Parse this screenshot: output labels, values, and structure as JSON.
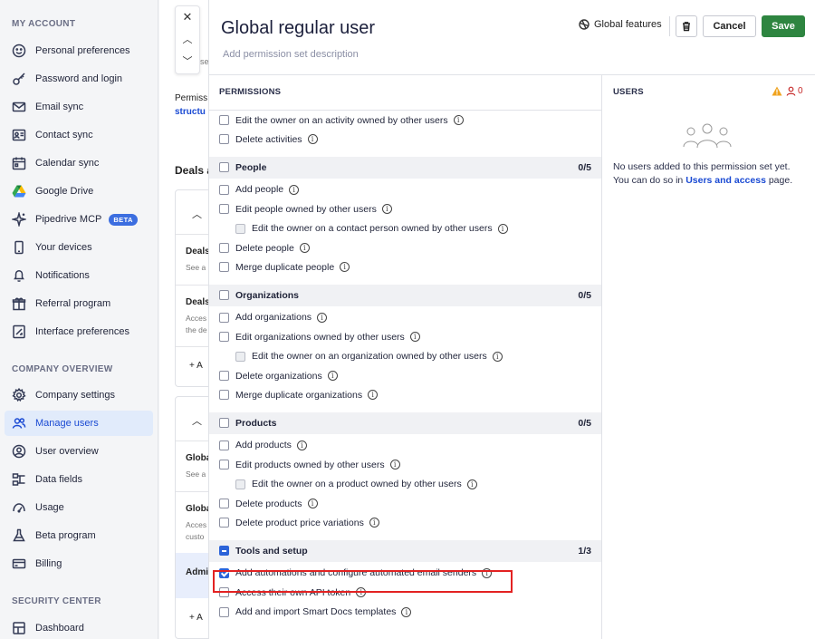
{
  "sidebar": {
    "sections": [
      {
        "heading": "MY ACCOUNT",
        "items": [
          {
            "label": "Personal preferences",
            "icon": "smiley-icon"
          },
          {
            "label": "Password and login",
            "icon": "key-icon"
          },
          {
            "label": "Email sync",
            "icon": "mail-icon"
          },
          {
            "label": "Contact sync",
            "icon": "contact-card-icon"
          },
          {
            "label": "Calendar sync",
            "icon": "calendar-icon"
          },
          {
            "label": "Google Drive",
            "icon": "google-drive-icon"
          },
          {
            "label": "Pipedrive MCP",
            "icon": "sparkle-icon",
            "badge": "BETA"
          },
          {
            "label": "Your devices",
            "icon": "phone-icon"
          },
          {
            "label": "Notifications",
            "icon": "bell-icon"
          },
          {
            "label": "Referral program",
            "icon": "gift-icon"
          },
          {
            "label": "Interface preferences",
            "icon": "interface-icon"
          }
        ]
      },
      {
        "heading": "COMPANY OVERVIEW",
        "items": [
          {
            "label": "Company settings",
            "icon": "gear-icon"
          },
          {
            "label": "Manage users",
            "icon": "users-icon",
            "active": true
          },
          {
            "label": "User overview",
            "icon": "user-circle-icon"
          },
          {
            "label": "Data fields",
            "icon": "data-fields-icon"
          },
          {
            "label": "Usage",
            "icon": "gauge-icon"
          },
          {
            "label": "Beta program",
            "icon": "flask-icon"
          },
          {
            "label": "Billing",
            "icon": "credit-card-icon"
          }
        ]
      },
      {
        "heading": "SECURITY CENTER",
        "items": [
          {
            "label": "Dashboard",
            "icon": "dashboard-icon"
          }
        ]
      }
    ]
  },
  "background": {
    "perm_text": "Permiss",
    "link_text": "structu",
    "deals_heading": "Deals a",
    "card1_rows": [
      {
        "title": "Deals",
        "sub": "See a"
      },
      {
        "title": "Deals",
        "sub": "Acces",
        "sub2": "the de"
      }
    ],
    "card1_add": "+ A",
    "card2_rows": [
      {
        "title": "Globa",
        "sub": "See a"
      },
      {
        "title": "Globa",
        "sub": "Acces",
        "sub2": "custo"
      },
      {
        "title": "Admi"
      }
    ],
    "card2_add": "+ A",
    "desc_fragment": "se"
  },
  "panel": {
    "title": "Global regular user",
    "description_placeholder": "Add permission set description",
    "global_features_label": "Global features",
    "cancel_label": "Cancel",
    "save_label": "Save",
    "permissions_heading": "PERMISSIONS",
    "users_heading": "USERS",
    "users_count": "0",
    "empty_text_1": "No users added to this permission set yet. You can do so in",
    "empty_link": "Users and access",
    "empty_text_2": "page.",
    "colors": {
      "save_green": "#2e8540",
      "accent_blue": "#2c64d9",
      "highlight_red": "#e32222"
    }
  },
  "permissions": [
    {
      "type": "item",
      "label": "Edit the owner on an activity owned by other users",
      "info": true,
      "checked": false
    },
    {
      "type": "item",
      "label": "Delete activities",
      "info": true,
      "checked": false
    },
    {
      "type": "group",
      "label": "People",
      "count": "0/5",
      "state": "unchecked"
    },
    {
      "type": "item",
      "label": "Add people",
      "info": true,
      "checked": false
    },
    {
      "type": "item",
      "label": "Edit people owned by other users",
      "info": true,
      "checked": false
    },
    {
      "type": "sub",
      "label": "Edit the owner on a contact person owned by other users",
      "info": true,
      "checked": false
    },
    {
      "type": "item",
      "label": "Delete people",
      "info": true,
      "checked": false
    },
    {
      "type": "item",
      "label": "Merge duplicate people",
      "info": true,
      "checked": false
    },
    {
      "type": "group",
      "label": "Organizations",
      "count": "0/5",
      "state": "unchecked"
    },
    {
      "type": "item",
      "label": "Add organizations",
      "info": true,
      "checked": false
    },
    {
      "type": "item",
      "label": "Edit organizations owned by other users",
      "info": true,
      "checked": false
    },
    {
      "type": "sub",
      "label": "Edit the owner on an organization owned by other users",
      "info": true,
      "checked": false
    },
    {
      "type": "item",
      "label": "Delete organizations",
      "info": true,
      "checked": false
    },
    {
      "type": "item",
      "label": "Merge duplicate organizations",
      "info": true,
      "checked": false
    },
    {
      "type": "group",
      "label": "Products",
      "count": "0/5",
      "state": "unchecked"
    },
    {
      "type": "item",
      "label": "Add products",
      "info": true,
      "checked": false
    },
    {
      "type": "item",
      "label": "Edit products owned by other users",
      "info": true,
      "checked": false
    },
    {
      "type": "sub",
      "label": "Edit the owner on a product owned by other users",
      "info": true,
      "checked": false
    },
    {
      "type": "item",
      "label": "Delete products",
      "info": true,
      "checked": false
    },
    {
      "type": "item",
      "label": "Delete product price variations",
      "info": true,
      "checked": false
    },
    {
      "type": "group",
      "label": "Tools and setup",
      "count": "1/3",
      "state": "partial"
    },
    {
      "type": "item",
      "label": "Add automations and configure automated email senders",
      "info": true,
      "checked": true
    },
    {
      "type": "item",
      "label": "Access their own API token",
      "info": true,
      "checked": false
    },
    {
      "type": "item",
      "label": "Add and import Smart Docs templates",
      "info": true,
      "checked": false
    }
  ]
}
